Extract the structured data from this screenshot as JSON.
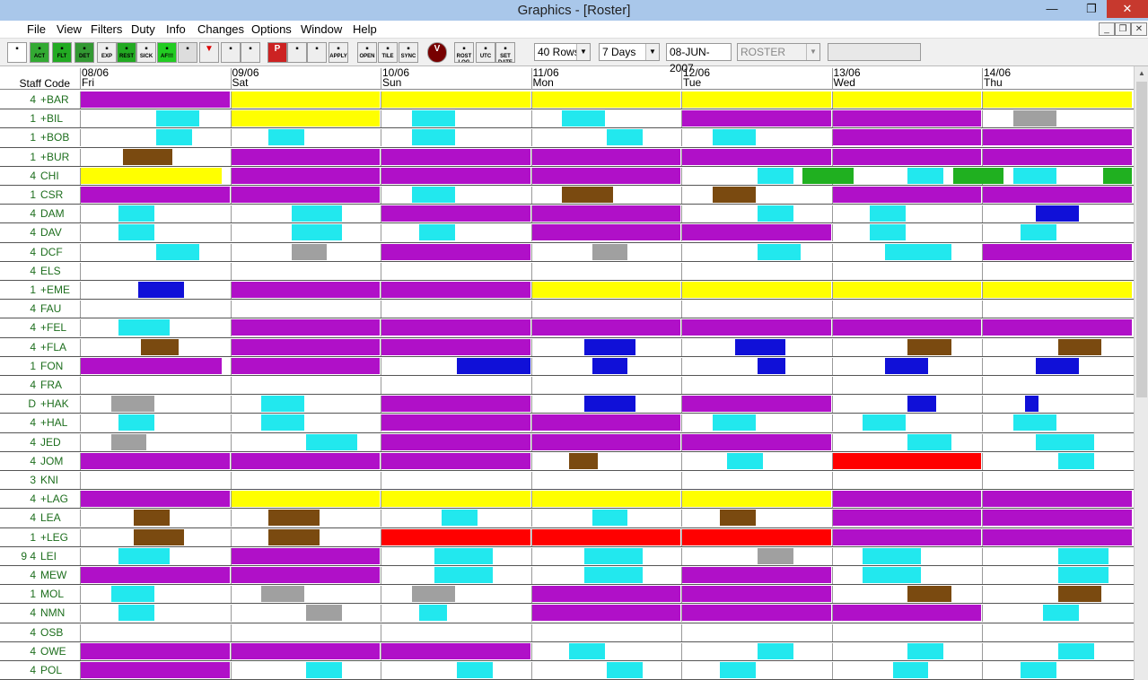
{
  "window": {
    "title": "Graphics - [Roster]",
    "minimize": "—",
    "maximize": "❐",
    "close": "✕"
  },
  "menu": [
    "File",
    "View",
    "Filters",
    "Duty",
    "Info",
    "Changes",
    "Options",
    "Window",
    "Help"
  ],
  "mdi_buttons": [
    "_",
    "❐",
    "✕"
  ],
  "toolbar": {
    "buttons": [
      {
        "name": "new-icon",
        "label": ""
      },
      {
        "name": "act-button",
        "label": "ACT"
      },
      {
        "name": "flt-button",
        "label": "FLT"
      },
      {
        "name": "det-button",
        "label": "DET"
      },
      {
        "name": "exp-button",
        "label": "EXP"
      },
      {
        "name": "rest-button",
        "label": "REST"
      },
      {
        "name": "sick-button",
        "label": "SICK"
      },
      {
        "name": "af-button",
        "label": "AF!!!"
      },
      {
        "name": "book-icon",
        "label": ""
      },
      {
        "name": "triangle-icon",
        "label": ""
      },
      {
        "name": "flag-icon",
        "label": ""
      },
      {
        "name": "flag-red-icon",
        "label": ""
      },
      {
        "name": "p-icon",
        "label": "P"
      },
      {
        "name": "undo-icon",
        "label": ""
      },
      {
        "name": "redo-icon",
        "label": ""
      },
      {
        "name": "apply-button",
        "label": "APPLY"
      },
      {
        "name": "open-button",
        "label": "OPEN"
      },
      {
        "name": "tile-button",
        "label": "TILE"
      },
      {
        "name": "sync-button",
        "label": "SYNC"
      },
      {
        "name": "v-icon",
        "label": "V"
      },
      {
        "name": "rost-log-button",
        "label": "ROST LOG"
      },
      {
        "name": "utc-button",
        "label": "UTC"
      },
      {
        "name": "set-date-button",
        "label": "SET DATE"
      }
    ],
    "rows_select": "40 Rows",
    "days_select": "7 Days",
    "date_field": "08-JUN-2007",
    "roster_select": "ROSTER"
  },
  "grid": {
    "staff_header": "Staff Code",
    "days": [
      {
        "date": "08/06",
        "dow": "Fri"
      },
      {
        "date": "09/06",
        "dow": "Sat"
      },
      {
        "date": "10/06",
        "dow": "Sun"
      },
      {
        "date": "11/06",
        "dow": "Mon"
      },
      {
        "date": "12/06",
        "dow": "Tue"
      },
      {
        "date": "13/06",
        "dow": "Wed"
      },
      {
        "date": "14/06",
        "dow": "Thu"
      }
    ],
    "colors": {
      "yellow": "#ffff00",
      "purple": "#b010c8",
      "cyan": "#22e8ee",
      "brown": "#7a4a10",
      "blue": "#1010d8",
      "grey": "#a0a0a0",
      "green": "#20b020",
      "red": "#ff0000"
    },
    "rows": [
      {
        "pre": "4",
        "code": "+BAR",
        "blocks": [
          [
            "purple",
            0,
            1
          ],
          [
            "yellow",
            1,
            2
          ],
          [
            "yellow",
            2,
            3
          ],
          [
            "yellow",
            3,
            4
          ],
          [
            "yellow",
            4,
            5
          ],
          [
            "yellow",
            5,
            6
          ],
          [
            "yellow",
            6,
            7
          ]
        ]
      },
      {
        "pre": "1",
        "code": "+BIL",
        "blocks": [
          [
            "cyan",
            0.5,
            0.8
          ],
          [
            "yellow",
            1,
            2
          ],
          [
            "cyan",
            2.2,
            2.5
          ],
          [
            "cyan",
            3.2,
            3.5
          ],
          [
            "purple",
            4,
            5
          ],
          [
            "purple",
            5,
            6
          ],
          [
            "grey",
            6.2,
            6.5
          ]
        ]
      },
      {
        "pre": "1",
        "code": "+BOB",
        "blocks": [
          [
            "cyan",
            0.5,
            0.75
          ],
          [
            "cyan",
            1.25,
            1.5
          ],
          [
            "cyan",
            2.2,
            2.5
          ],
          [
            "cyan",
            3.5,
            3.75
          ],
          [
            "cyan",
            4.2,
            4.5
          ],
          [
            "purple",
            5,
            6
          ],
          [
            "purple",
            6,
            7
          ]
        ]
      },
      {
        "pre": "1",
        "code": "+BUR",
        "blocks": [
          [
            "brown",
            0.28,
            0.62
          ],
          [
            "purple",
            1,
            2
          ],
          [
            "purple",
            2,
            3
          ],
          [
            "purple",
            3,
            4
          ],
          [
            "purple",
            4,
            5
          ],
          [
            "purple",
            5,
            6
          ],
          [
            "purple",
            6,
            7
          ]
        ]
      },
      {
        "pre": "4",
        "code": "CHI",
        "blocks": [
          [
            "yellow",
            0,
            0.95
          ],
          [
            "purple",
            1,
            2
          ],
          [
            "purple",
            2,
            3
          ],
          [
            "purple",
            3,
            4
          ],
          [
            "cyan",
            4.5,
            4.75
          ],
          [
            "green",
            4.8,
            5.15
          ],
          [
            "cyan",
            5.5,
            5.75
          ],
          [
            "green",
            5.8,
            6.15
          ],
          [
            "cyan",
            6.2,
            6.5
          ],
          [
            "green",
            6.8,
            7
          ]
        ]
      },
      {
        "pre": "1",
        "code": "CSR",
        "blocks": [
          [
            "purple",
            0,
            1
          ],
          [
            "purple",
            1,
            2
          ],
          [
            "cyan",
            2.2,
            2.5
          ],
          [
            "brown",
            3.2,
            3.55
          ],
          [
            "brown",
            4.2,
            4.5
          ],
          [
            "purple",
            5,
            6
          ],
          [
            "purple",
            6,
            7
          ]
        ]
      },
      {
        "pre": "4",
        "code": "DAM",
        "blocks": [
          [
            "cyan",
            0.25,
            0.5
          ],
          [
            "cyan",
            1.4,
            1.75
          ],
          [
            "purple",
            2,
            3
          ],
          [
            "purple",
            3,
            4
          ],
          [
            "cyan",
            4.5,
            4.75
          ],
          [
            "cyan",
            5.25,
            5.5
          ],
          [
            "blue",
            6.35,
            6.65
          ]
        ]
      },
      {
        "pre": "4",
        "code": "DAV",
        "blocks": [
          [
            "cyan",
            0.25,
            0.5
          ],
          [
            "cyan",
            1.4,
            1.75
          ],
          [
            "cyan",
            2.25,
            2.5
          ],
          [
            "purple",
            3,
            4
          ],
          [
            "purple",
            4,
            5
          ],
          [
            "cyan",
            5.25,
            5.5
          ],
          [
            "cyan",
            6.25,
            6.5
          ]
        ]
      },
      {
        "pre": "4",
        "code": "DCF",
        "blocks": [
          [
            "cyan",
            0.5,
            0.8
          ],
          [
            "grey",
            1.4,
            1.65
          ],
          [
            "purple",
            2,
            3
          ],
          [
            "grey",
            3.4,
            3.65
          ],
          [
            "cyan",
            4.5,
            4.8
          ],
          [
            "cyan",
            5.35,
            5.8
          ],
          [
            "purple",
            6,
            7
          ]
        ]
      },
      {
        "pre": "4",
        "code": "ELS",
        "blocks": []
      },
      {
        "pre": "1",
        "code": "+EME",
        "blocks": [
          [
            "blue",
            0.38,
            0.7
          ],
          [
            "purple",
            1,
            2
          ],
          [
            "purple",
            2,
            3
          ],
          [
            "yellow",
            3,
            4
          ],
          [
            "yellow",
            4,
            5
          ],
          [
            "yellow",
            5,
            6
          ],
          [
            "yellow",
            6,
            7
          ]
        ]
      },
      {
        "pre": "4",
        "code": "FAU",
        "blocks": []
      },
      {
        "pre": "4",
        "code": "+FEL",
        "blocks": [
          [
            "cyan",
            0.25,
            0.6
          ],
          [
            "purple",
            1,
            2
          ],
          [
            "purple",
            2,
            3
          ],
          [
            "purple",
            3,
            4
          ],
          [
            "purple",
            4,
            5
          ],
          [
            "purple",
            5,
            6
          ],
          [
            "purple",
            6,
            7
          ]
        ]
      },
      {
        "pre": "4",
        "code": "+FLA",
        "blocks": [
          [
            "brown",
            0.4,
            0.66
          ],
          [
            "purple",
            1,
            2
          ],
          [
            "purple",
            2,
            3
          ],
          [
            "blue",
            3.35,
            3.7
          ],
          [
            "blue",
            4.35,
            4.7
          ],
          [
            "brown",
            5.5,
            5.8
          ],
          [
            "brown",
            6.5,
            6.8
          ]
        ]
      },
      {
        "pre": "1",
        "code": "FON",
        "blocks": [
          [
            "purple",
            0,
            0.95
          ],
          [
            "purple",
            1,
            2
          ],
          [
            "blue",
            2.5,
            3
          ],
          [
            "blue",
            3.4,
            3.65
          ],
          [
            "blue",
            4.5,
            4.7
          ],
          [
            "blue",
            5.35,
            5.65
          ],
          [
            "blue",
            6.35,
            6.65
          ]
        ]
      },
      {
        "pre": "4",
        "code": "FRA",
        "blocks": []
      },
      {
        "pre": "D",
        "code": "+HAK",
        "blocks": [
          [
            "grey",
            0.2,
            0.5
          ],
          [
            "cyan",
            1.2,
            1.5
          ],
          [
            "purple",
            2,
            3
          ],
          [
            "blue",
            3.35,
            3.7
          ],
          [
            "purple",
            4,
            5
          ],
          [
            "blue",
            5.5,
            5.7
          ],
          [
            "blue",
            6.28,
            6.38
          ]
        ]
      },
      {
        "pre": "4",
        "code": "+HAL",
        "blocks": [
          [
            "cyan",
            0.25,
            0.5
          ],
          [
            "cyan",
            1.2,
            1.5
          ],
          [
            "purple",
            2,
            3
          ],
          [
            "purple",
            3,
            4
          ],
          [
            "cyan",
            4.2,
            4.5
          ],
          [
            "cyan",
            5.2,
            5.5
          ],
          [
            "cyan",
            6.2,
            6.5
          ]
        ]
      },
      {
        "pre": "4",
        "code": "JED",
        "blocks": [
          [
            "grey",
            0.2,
            0.45
          ],
          [
            "cyan",
            1.5,
            1.85
          ],
          [
            "purple",
            2,
            3
          ],
          [
            "purple",
            3,
            4
          ],
          [
            "purple",
            4,
            5
          ],
          [
            "cyan",
            5.5,
            5.8
          ],
          [
            "cyan",
            6.35,
            6.75
          ]
        ]
      },
      {
        "pre": "4",
        "code": "JOM",
        "blocks": [
          [
            "purple",
            0,
            1
          ],
          [
            "purple",
            1,
            2
          ],
          [
            "purple",
            2,
            3
          ],
          [
            "brown",
            3.25,
            3.45
          ],
          [
            "cyan",
            4.3,
            4.55
          ],
          [
            "red",
            5,
            6
          ],
          [
            "cyan",
            6.5,
            6.75
          ]
        ]
      },
      {
        "pre": "3",
        "code": "KNI",
        "blocks": []
      },
      {
        "pre": "4",
        "code": "+LAG",
        "blocks": [
          [
            "purple",
            0,
            1
          ],
          [
            "yellow",
            1,
            2
          ],
          [
            "yellow",
            2,
            3
          ],
          [
            "yellow",
            3,
            4
          ],
          [
            "yellow",
            4,
            5
          ],
          [
            "purple",
            5,
            6
          ],
          [
            "purple",
            6,
            7
          ]
        ]
      },
      {
        "pre": "4",
        "code": "LEA",
        "blocks": [
          [
            "brown",
            0.35,
            0.6
          ],
          [
            "brown",
            1.25,
            1.6
          ],
          [
            "cyan",
            2.4,
            2.65
          ],
          [
            "cyan",
            3.4,
            3.65
          ],
          [
            "brown",
            4.25,
            4.5
          ],
          [
            "purple",
            5,
            6
          ],
          [
            "purple",
            6,
            7
          ]
        ]
      },
      {
        "pre": "1",
        "code": "+LEG",
        "blocks": [
          [
            "brown",
            0.35,
            0.7
          ],
          [
            "brown",
            1.25,
            1.6
          ],
          [
            "red",
            2,
            3
          ],
          [
            "red",
            3,
            4
          ],
          [
            "red",
            4,
            5
          ],
          [
            "purple",
            5,
            6
          ],
          [
            "purple",
            6,
            7
          ]
        ]
      },
      {
        "pre": "9 4",
        "code": "LEI",
        "blocks": [
          [
            "cyan",
            0.25,
            0.6
          ],
          [
            "purple",
            1,
            2
          ],
          [
            "cyan",
            2.35,
            2.75
          ],
          [
            "cyan",
            3.35,
            3.75
          ],
          [
            "grey",
            4.5,
            4.75
          ],
          [
            "cyan",
            5.2,
            5.6
          ],
          [
            "cyan",
            6.5,
            6.85
          ]
        ]
      },
      {
        "pre": "4",
        "code": "MEW",
        "blocks": [
          [
            "purple",
            0,
            1
          ],
          [
            "purple",
            1,
            2
          ],
          [
            "cyan",
            2.35,
            2.75
          ],
          [
            "cyan",
            3.35,
            3.75
          ],
          [
            "purple",
            4,
            5
          ],
          [
            "cyan",
            5.2,
            5.6
          ],
          [
            "cyan",
            6.5,
            6.85
          ]
        ]
      },
      {
        "pre": "1",
        "code": "MOL",
        "blocks": [
          [
            "cyan",
            0.2,
            0.5
          ],
          [
            "grey",
            1.2,
            1.5
          ],
          [
            "grey",
            2.2,
            2.5
          ],
          [
            "purple",
            3,
            4
          ],
          [
            "purple",
            4,
            5
          ],
          [
            "brown",
            5.5,
            5.8
          ],
          [
            "brown",
            6.5,
            6.8
          ]
        ]
      },
      {
        "pre": "4",
        "code": "NMN",
        "blocks": [
          [
            "cyan",
            0.25,
            0.5
          ],
          [
            "grey",
            1.5,
            1.75
          ],
          [
            "cyan",
            2.25,
            2.45
          ],
          [
            "purple",
            3,
            4
          ],
          [
            "purple",
            4,
            5
          ],
          [
            "purple",
            5,
            6
          ],
          [
            "cyan",
            6.4,
            6.65
          ]
        ]
      },
      {
        "pre": "4",
        "code": "OSB",
        "blocks": []
      },
      {
        "pre": "4",
        "code": "OWE",
        "blocks": [
          [
            "purple",
            0,
            1
          ],
          [
            "purple",
            1,
            2
          ],
          [
            "purple",
            2,
            3
          ],
          [
            "cyan",
            3.25,
            3.5
          ],
          [
            "cyan",
            4.5,
            4.75
          ],
          [
            "cyan",
            5.5,
            5.75
          ],
          [
            "cyan",
            6.5,
            6.75
          ]
        ]
      },
      {
        "pre": "4",
        "code": "POL",
        "blocks": [
          [
            "purple",
            0,
            1
          ],
          [
            "cyan",
            1.5,
            1.75
          ],
          [
            "cyan",
            2.5,
            2.75
          ],
          [
            "cyan",
            3.5,
            3.75
          ],
          [
            "cyan",
            4.25,
            4.5
          ],
          [
            "cyan",
            5.4,
            5.65
          ],
          [
            "cyan",
            6.25,
            6.5
          ]
        ]
      }
    ]
  }
}
